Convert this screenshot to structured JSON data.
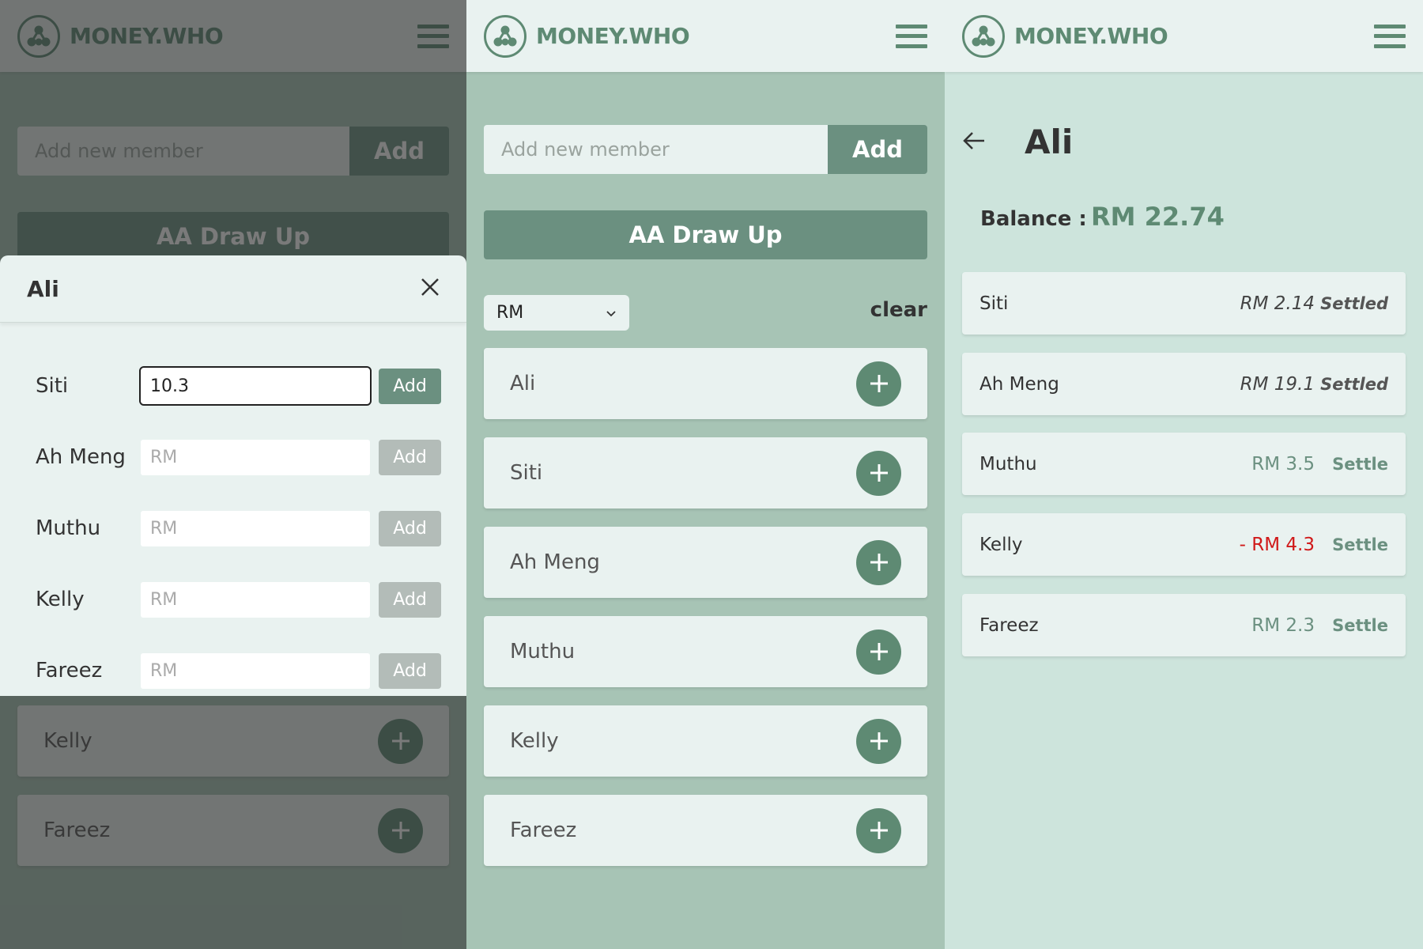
{
  "colors": {
    "brand": "#5e8a73",
    "button": "#6b9080",
    "card": "#e9f2f0",
    "negative": "#d01919"
  },
  "app": {
    "logo_text": "MONEY.WHO",
    "logo_icon": "network-nodes-icon",
    "menu_icon": "hamburger-menu-icon"
  },
  "home": {
    "add_placeholder": "Add new member",
    "add_label": "Add",
    "draw_up_label": "AA Draw Up",
    "currency": "RM",
    "clear_label": "clear",
    "members": [
      "Ali",
      "Siti",
      "Ah Meng",
      "Muthu",
      "Kelly",
      "Fareez"
    ]
  },
  "modal": {
    "title": "Ali",
    "close_icon": "close-icon",
    "add_label": "Add",
    "placeholder": "RM",
    "rows": [
      {
        "name": "Siti",
        "value": "10.3",
        "active": true
      },
      {
        "name": "Ah Meng",
        "value": "",
        "active": false
      },
      {
        "name": "Muthu",
        "value": "",
        "active": false
      },
      {
        "name": "Kelly",
        "value": "",
        "active": false
      },
      {
        "name": "Fareez",
        "value": "",
        "active": false
      }
    ]
  },
  "detail": {
    "name": "Ali",
    "balance_label": "Balance :",
    "balance_value": "RM 22.74",
    "debts": [
      {
        "name": "Siti",
        "amount": "RM 2.14",
        "status": "Settled",
        "state": "settled"
      },
      {
        "name": "Ah Meng",
        "amount": "RM 19.1",
        "status": "Settled",
        "state": "settled"
      },
      {
        "name": "Muthu",
        "amount": "RM 3.5",
        "status": "Settle",
        "state": "pos"
      },
      {
        "name": "Kelly",
        "amount": "- RM 4.3",
        "status": "Settle",
        "state": "neg"
      },
      {
        "name": "Fareez",
        "amount": "RM 2.3",
        "status": "Settle",
        "state": "pos"
      }
    ]
  }
}
